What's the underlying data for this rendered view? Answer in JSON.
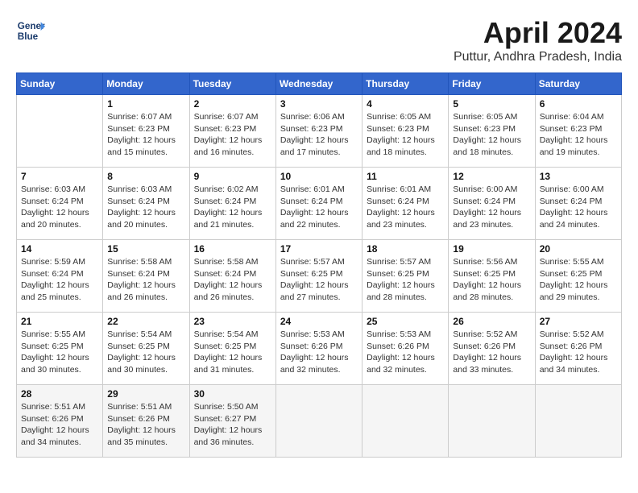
{
  "header": {
    "logo_line1": "General",
    "logo_line2": "Blue",
    "month_year": "April 2024",
    "location": "Puttur, Andhra Pradesh, India"
  },
  "calendar": {
    "columns": [
      "Sunday",
      "Monday",
      "Tuesday",
      "Wednesday",
      "Thursday",
      "Friday",
      "Saturday"
    ],
    "weeks": [
      [
        {
          "day": "",
          "info": ""
        },
        {
          "day": "1",
          "info": "Sunrise: 6:07 AM\nSunset: 6:23 PM\nDaylight: 12 hours\nand 15 minutes."
        },
        {
          "day": "2",
          "info": "Sunrise: 6:07 AM\nSunset: 6:23 PM\nDaylight: 12 hours\nand 16 minutes."
        },
        {
          "day": "3",
          "info": "Sunrise: 6:06 AM\nSunset: 6:23 PM\nDaylight: 12 hours\nand 17 minutes."
        },
        {
          "day": "4",
          "info": "Sunrise: 6:05 AM\nSunset: 6:23 PM\nDaylight: 12 hours\nand 18 minutes."
        },
        {
          "day": "5",
          "info": "Sunrise: 6:05 AM\nSunset: 6:23 PM\nDaylight: 12 hours\nand 18 minutes."
        },
        {
          "day": "6",
          "info": "Sunrise: 6:04 AM\nSunset: 6:23 PM\nDaylight: 12 hours\nand 19 minutes."
        }
      ],
      [
        {
          "day": "7",
          "info": "Sunrise: 6:03 AM\nSunset: 6:24 PM\nDaylight: 12 hours\nand 20 minutes."
        },
        {
          "day": "8",
          "info": "Sunrise: 6:03 AM\nSunset: 6:24 PM\nDaylight: 12 hours\nand 20 minutes."
        },
        {
          "day": "9",
          "info": "Sunrise: 6:02 AM\nSunset: 6:24 PM\nDaylight: 12 hours\nand 21 minutes."
        },
        {
          "day": "10",
          "info": "Sunrise: 6:01 AM\nSunset: 6:24 PM\nDaylight: 12 hours\nand 22 minutes."
        },
        {
          "day": "11",
          "info": "Sunrise: 6:01 AM\nSunset: 6:24 PM\nDaylight: 12 hours\nand 23 minutes."
        },
        {
          "day": "12",
          "info": "Sunrise: 6:00 AM\nSunset: 6:24 PM\nDaylight: 12 hours\nand 23 minutes."
        },
        {
          "day": "13",
          "info": "Sunrise: 6:00 AM\nSunset: 6:24 PM\nDaylight: 12 hours\nand 24 minutes."
        }
      ],
      [
        {
          "day": "14",
          "info": "Sunrise: 5:59 AM\nSunset: 6:24 PM\nDaylight: 12 hours\nand 25 minutes."
        },
        {
          "day": "15",
          "info": "Sunrise: 5:58 AM\nSunset: 6:24 PM\nDaylight: 12 hours\nand 26 minutes."
        },
        {
          "day": "16",
          "info": "Sunrise: 5:58 AM\nSunset: 6:24 PM\nDaylight: 12 hours\nand 26 minutes."
        },
        {
          "day": "17",
          "info": "Sunrise: 5:57 AM\nSunset: 6:25 PM\nDaylight: 12 hours\nand 27 minutes."
        },
        {
          "day": "18",
          "info": "Sunrise: 5:57 AM\nSunset: 6:25 PM\nDaylight: 12 hours\nand 28 minutes."
        },
        {
          "day": "19",
          "info": "Sunrise: 5:56 AM\nSunset: 6:25 PM\nDaylight: 12 hours\nand 28 minutes."
        },
        {
          "day": "20",
          "info": "Sunrise: 5:55 AM\nSunset: 6:25 PM\nDaylight: 12 hours\nand 29 minutes."
        }
      ],
      [
        {
          "day": "21",
          "info": "Sunrise: 5:55 AM\nSunset: 6:25 PM\nDaylight: 12 hours\nand 30 minutes."
        },
        {
          "day": "22",
          "info": "Sunrise: 5:54 AM\nSunset: 6:25 PM\nDaylight: 12 hours\nand 30 minutes."
        },
        {
          "day": "23",
          "info": "Sunrise: 5:54 AM\nSunset: 6:25 PM\nDaylight: 12 hours\nand 31 minutes."
        },
        {
          "day": "24",
          "info": "Sunrise: 5:53 AM\nSunset: 6:26 PM\nDaylight: 12 hours\nand 32 minutes."
        },
        {
          "day": "25",
          "info": "Sunrise: 5:53 AM\nSunset: 6:26 PM\nDaylight: 12 hours\nand 32 minutes."
        },
        {
          "day": "26",
          "info": "Sunrise: 5:52 AM\nSunset: 6:26 PM\nDaylight: 12 hours\nand 33 minutes."
        },
        {
          "day": "27",
          "info": "Sunrise: 5:52 AM\nSunset: 6:26 PM\nDaylight: 12 hours\nand 34 minutes."
        }
      ],
      [
        {
          "day": "28",
          "info": "Sunrise: 5:51 AM\nSunset: 6:26 PM\nDaylight: 12 hours\nand 34 minutes."
        },
        {
          "day": "29",
          "info": "Sunrise: 5:51 AM\nSunset: 6:26 PM\nDaylight: 12 hours\nand 35 minutes."
        },
        {
          "day": "30",
          "info": "Sunrise: 5:50 AM\nSunset: 6:27 PM\nDaylight: 12 hours\nand 36 minutes."
        },
        {
          "day": "",
          "info": ""
        },
        {
          "day": "",
          "info": ""
        },
        {
          "day": "",
          "info": ""
        },
        {
          "day": "",
          "info": ""
        }
      ]
    ]
  }
}
